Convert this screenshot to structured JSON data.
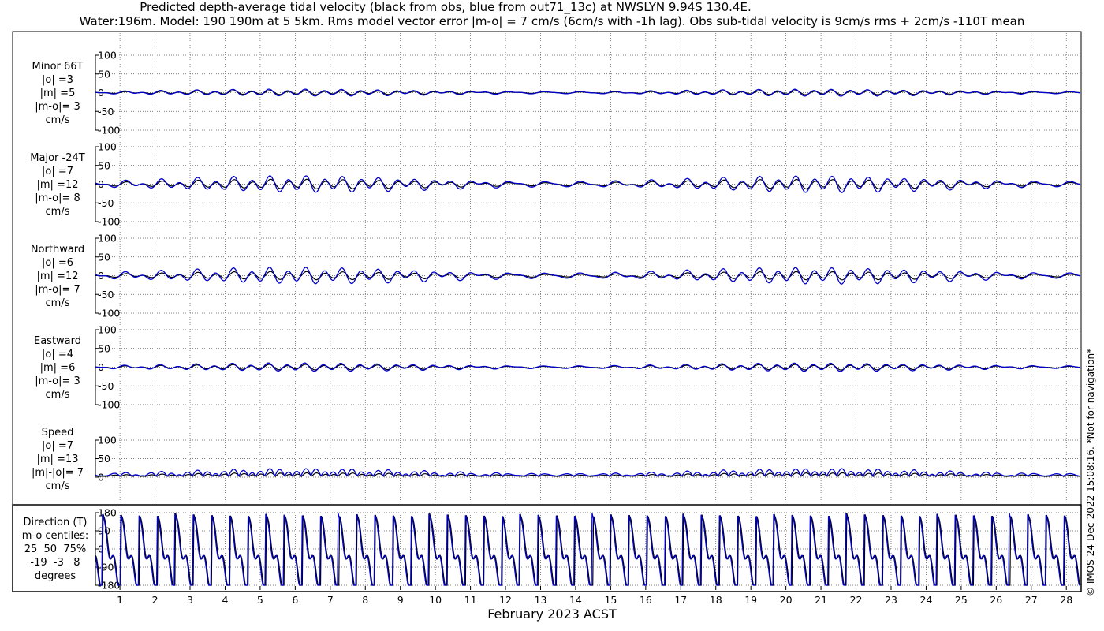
{
  "title_line1": "Predicted depth-average tidal velocity (black from obs, blue from out71_13c) at NWSLYN 9.94S 130.4E.",
  "title_line2": "Water:196m. Model: 190 190m at 5 5km. Rms model vector error |m-o| = 7 cm/s (6cm/s with -1h lag). Obs sub-tidal velocity is 9cm/s rms + 2cm/s -110T mean",
  "credit": "© IMOS 24-Dec-2022 15:08:16. *Not for navigation*",
  "colors": {
    "obs": "#000000",
    "model": "#0000cc",
    "grid": "#555555"
  },
  "chart_data": [
    {
      "type": "line",
      "panel": "minor",
      "label": "Minor 66T\n|o| =3\n|m| =5\n|m-o|= 3\ncm/s",
      "ylim": [
        -100,
        100
      ],
      "yticks": [
        100,
        50,
        0,
        -50,
        -100
      ],
      "obs_amp": 3,
      "model_amp": 5
    },
    {
      "type": "line",
      "panel": "major",
      "label": "Major -24T\n|o| =7\n|m| =12\n|m-o|= 8\ncm/s",
      "ylim": [
        -100,
        100
      ],
      "yticks": [
        100,
        50,
        0,
        -50,
        -100
      ],
      "obs_amp": 7,
      "model_amp": 12
    },
    {
      "type": "line",
      "panel": "north",
      "label": "Northward\n|o| =6\n|m| =12\n|m-o|= 7\ncm/s",
      "ylim": [
        -100,
        100
      ],
      "yticks": [
        100,
        50,
        0,
        -50,
        -100
      ],
      "obs_amp": 6,
      "model_amp": 12
    },
    {
      "type": "line",
      "panel": "east",
      "label": "Eastward\n|o| =4\n|m| =6\n|m-o|= 3\ncm/s",
      "ylim": [
        -100,
        100
      ],
      "yticks": [
        100,
        50,
        0,
        -50,
        -100
      ],
      "obs_amp": 4,
      "model_amp": 6
    },
    {
      "type": "line",
      "panel": "speed",
      "label": "Speed\n|o| =7\n|m| =13\n|m|-|o|= 7\ncm/s",
      "ylim": [
        0,
        100
      ],
      "yticks": [
        100,
        50,
        0
      ],
      "obs_amp": 7,
      "model_amp": 13
    },
    {
      "type": "line",
      "panel": "direction",
      "label": "Direction (T)\nm-o centiles:\n25  50  75%\n-19  -3   8\ndegrees",
      "ylim": [
        -180,
        180
      ],
      "yticks": [
        180,
        90,
        0,
        -90,
        -180
      ]
    }
  ],
  "x_axis": {
    "label": "February 2023 ACST",
    "xlim": [
      0.3,
      28.4
    ],
    "ticks": [
      1,
      2,
      3,
      4,
      5,
      6,
      7,
      8,
      9,
      10,
      11,
      12,
      13,
      14,
      15,
      16,
      17,
      18,
      19,
      20,
      21,
      22,
      23,
      24,
      25,
      26,
      27,
      28
    ]
  }
}
